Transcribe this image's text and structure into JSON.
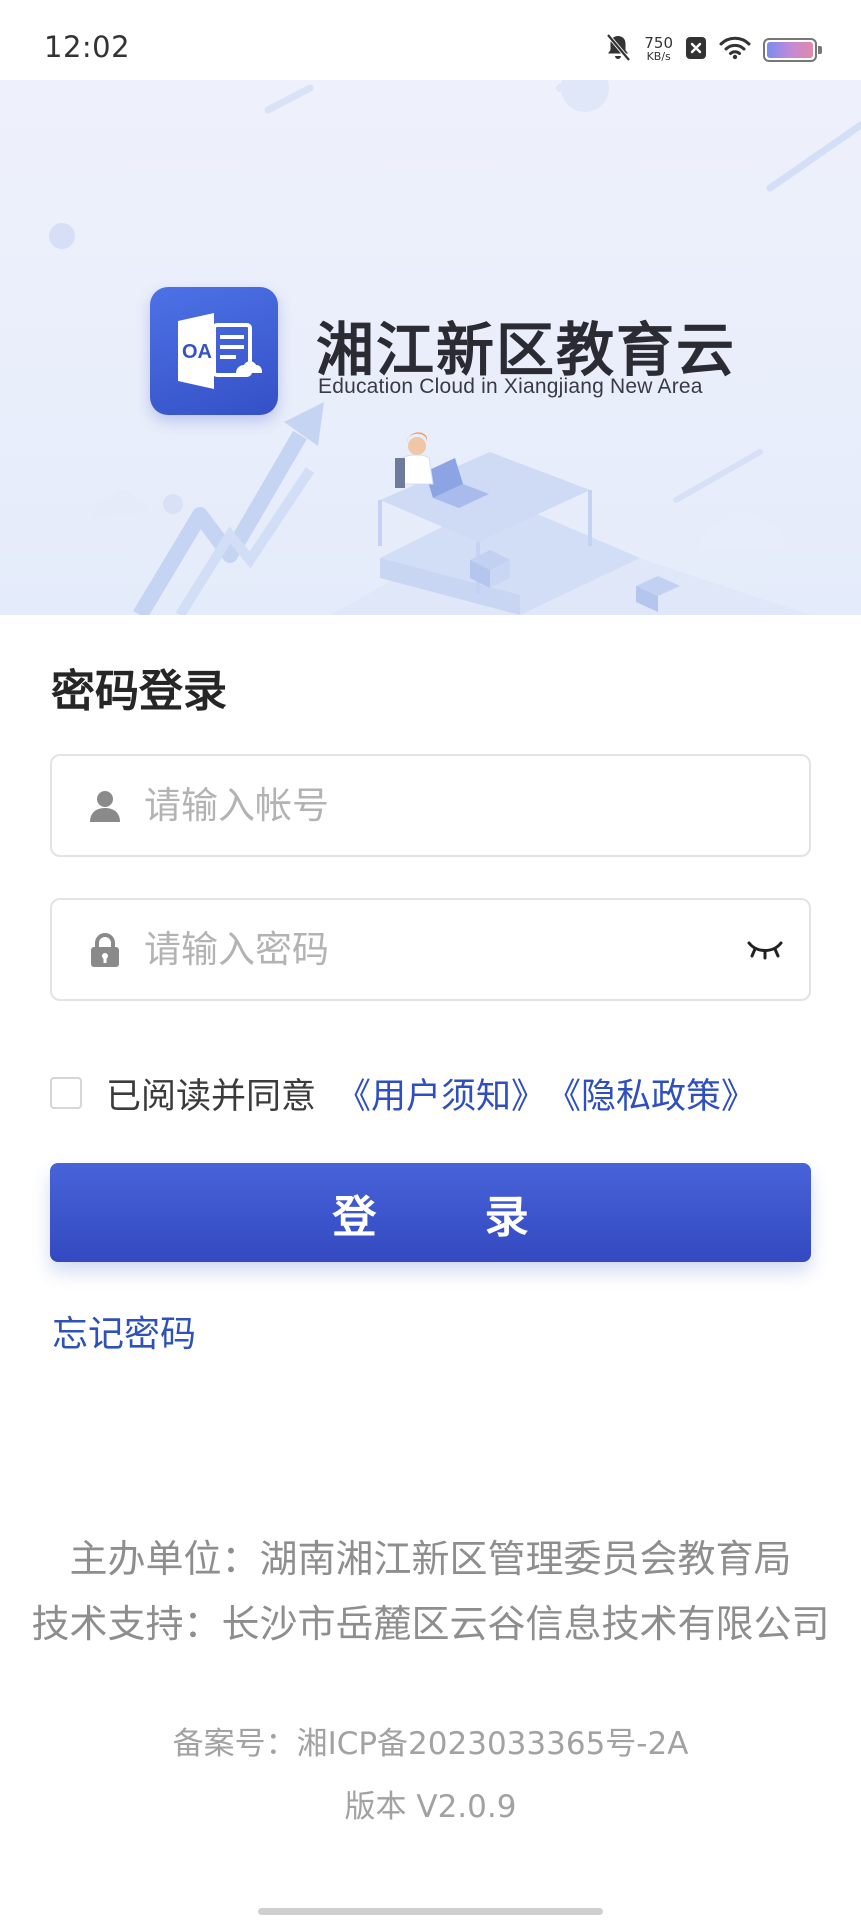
{
  "status_bar": {
    "time": "12:02",
    "net_speed_value": "750",
    "net_speed_unit": "KB/s",
    "icons": [
      "bell-muted-icon",
      "sim-blocked-icon",
      "wifi-icon",
      "battery-icon"
    ]
  },
  "banner": {
    "logo_text": "OA",
    "title": "湘江新区教育云",
    "subtitle": "Education Cloud in Xiangjiang New Area"
  },
  "login": {
    "title": "密码登录",
    "account_placeholder": "请输入帐号",
    "account_value": "",
    "password_placeholder": "请输入密码",
    "password_value": "",
    "agree_text": "已阅读并同意",
    "agree_checked": false,
    "user_notice_link": "《用户须知》",
    "privacy_link": "《隐私政策》",
    "submit_label": "登 录",
    "forgot_label": "忘记密码"
  },
  "footer": {
    "host": "主办单位：湖南湘江新区管理委员会教育局",
    "tech": "技术支持：长沙市岳麓区云谷信息技术有限公司",
    "icp": "备案号：湘ICP备2023033365号-2A",
    "version": "版本 V2.0.9"
  },
  "colors": {
    "primary": "#3a52c9",
    "link": "#2f4fbf",
    "placeholder": "#b3b3b3",
    "footer_text": "#8e8e8e"
  }
}
